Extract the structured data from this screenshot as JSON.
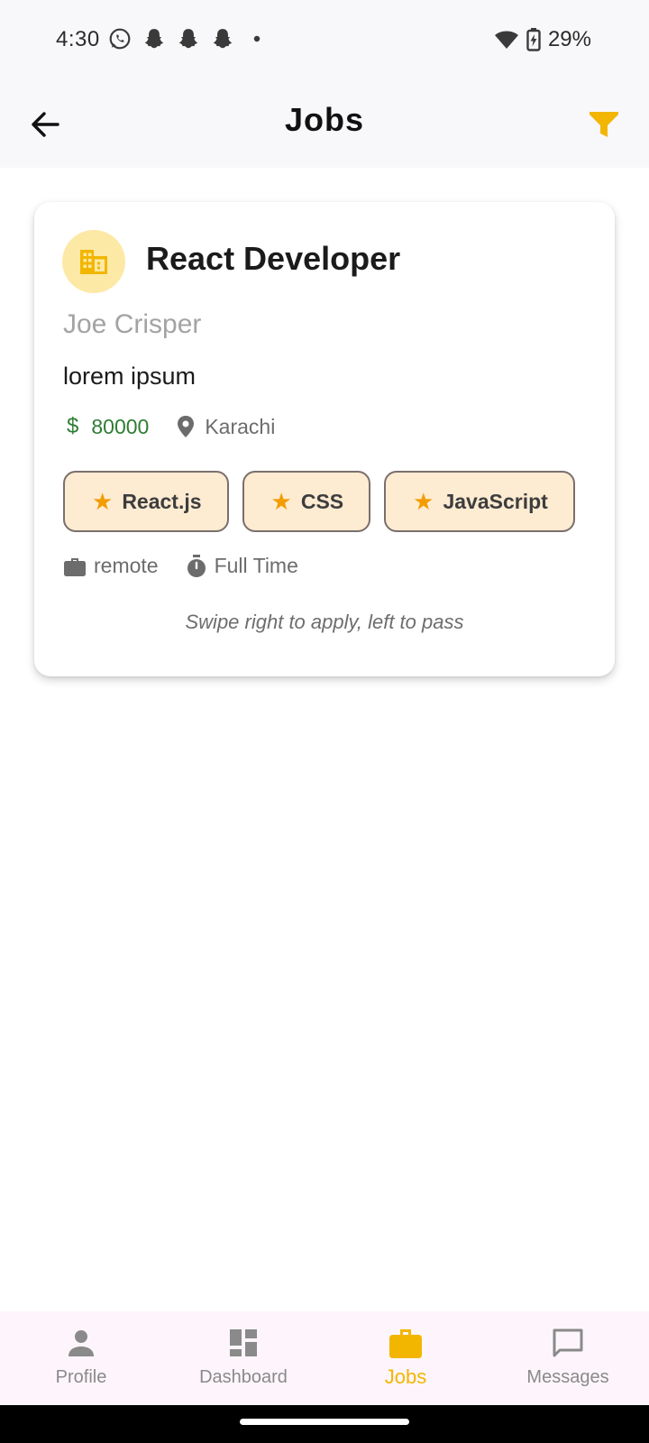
{
  "status_bar": {
    "time": "4:30",
    "battery": "29%"
  },
  "app_bar": {
    "title": "Jobs"
  },
  "job": {
    "title": "React Developer",
    "company": "Joe Crisper",
    "description": "lorem ipsum",
    "salary": "80000",
    "location": "Karachi",
    "skills": [
      "React.js",
      "CSS",
      "JavaScript"
    ],
    "work_mode": "remote",
    "employment_type": "Full Time",
    "swipe_hint": "Swipe right to apply, left to pass"
  },
  "bottom_nav": {
    "items": [
      {
        "label": "Profile",
        "icon": "person-icon"
      },
      {
        "label": "Dashboard",
        "icon": "dashboard-icon"
      },
      {
        "label": "Jobs",
        "icon": "briefcase-icon",
        "active": true
      },
      {
        "label": "Messages",
        "icon": "chat-bubble-icon"
      }
    ]
  },
  "colors": {
    "accent": "#F2B600",
    "salary": "#2E7D32",
    "chip_bg": "#FDEBD2",
    "star": "#F39C00"
  }
}
